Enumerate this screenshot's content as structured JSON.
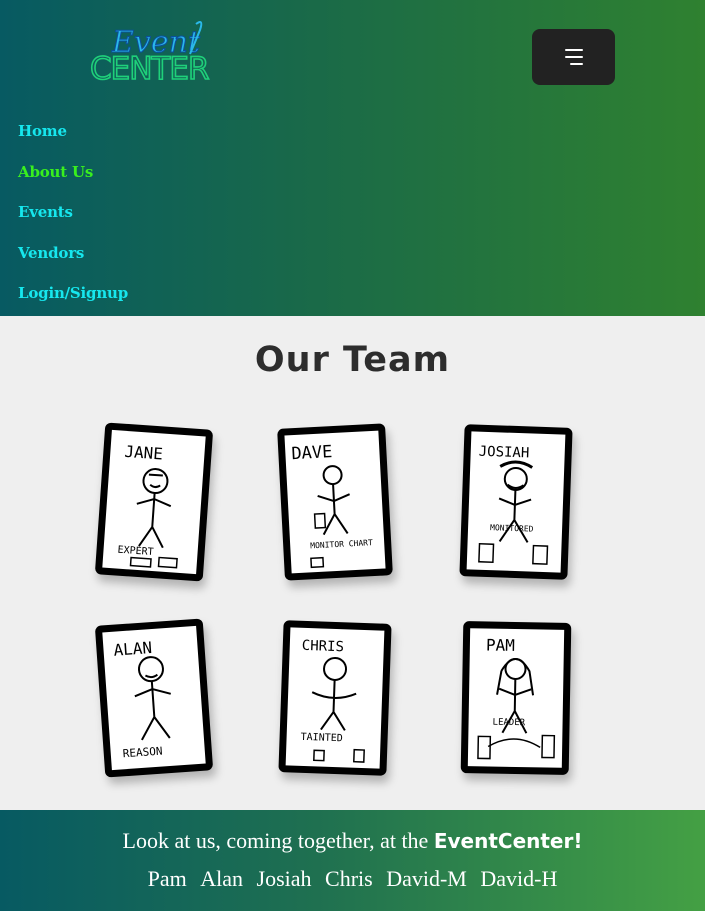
{
  "header": {
    "logo_top": "Event",
    "logo_bottom": "CENTER",
    "menu_icon": "hamburger-menu-icon",
    "nav": [
      {
        "label": "Home",
        "active": false
      },
      {
        "label": "About Us",
        "active": true
      },
      {
        "label": "Events",
        "active": false
      },
      {
        "label": "Vendors",
        "active": false
      },
      {
        "label": "Login/Signup",
        "active": false
      }
    ]
  },
  "main": {
    "title": "Our Team",
    "cards": [
      {
        "name": "JANE",
        "caption": "EXPERT"
      },
      {
        "name": "DAVE",
        "caption": "MONITOR CHART"
      },
      {
        "name": "JOSIAH",
        "caption": "MONITORED"
      },
      {
        "name": "ALAN",
        "caption": "REASON"
      },
      {
        "name": "CHRIS",
        "caption": "TAINTED"
      },
      {
        "name": "PAM",
        "caption": "LEADER"
      }
    ]
  },
  "footer": {
    "tagline_prefix": "Look at us, coming together, at the ",
    "tagline_brand": "EventCenter!",
    "names": [
      "Pam",
      "Alan",
      "Josiah",
      "Chris",
      "David-M",
      "David-H"
    ]
  },
  "colors": {
    "nav_text": "#16e7ee",
    "nav_active": "#39f01e",
    "title": "#2d2d2d",
    "menu_button": "#222222"
  }
}
